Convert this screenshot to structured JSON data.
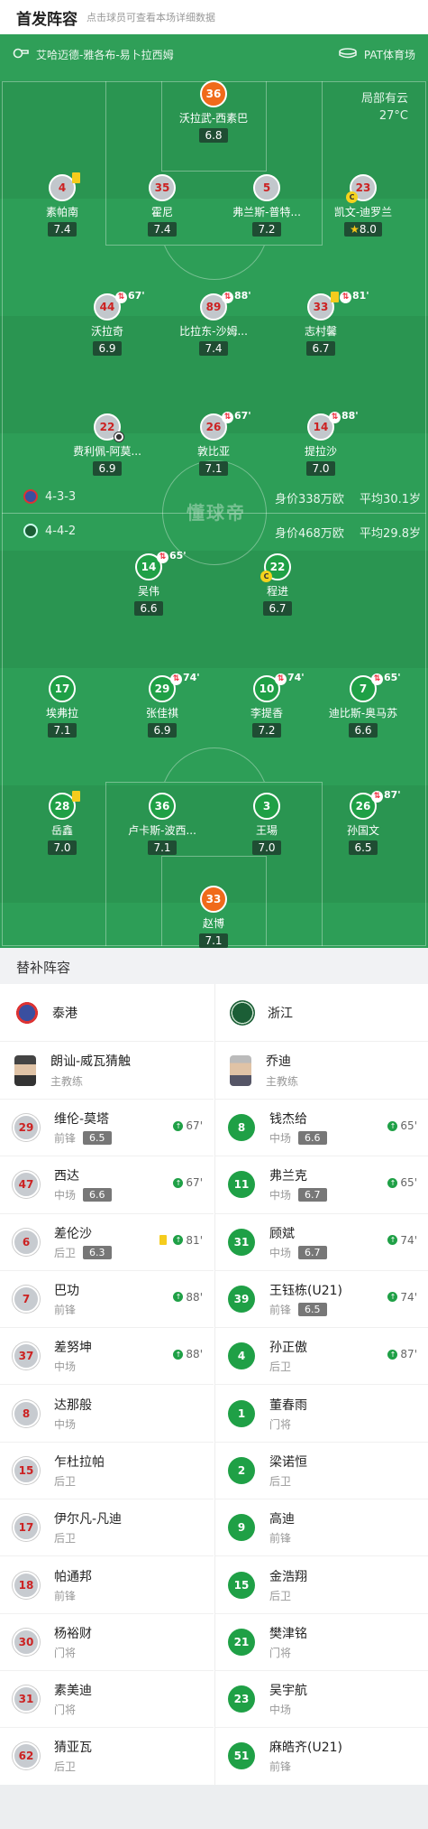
{
  "header": {
    "title": "首发阵容",
    "subtitle": "点击球员可查看本场详细数据"
  },
  "pitch": {
    "venue_left": "艾哈迈德-雅各布-易卜拉西姆",
    "venue_right": "PAT体育场",
    "weather": "局部有云",
    "temperature": "27°C",
    "watermark": "懂球帝",
    "home_form": {
      "formation": "4-3-3",
      "value": "身价338万欧",
      "age": "平均30.1岁"
    },
    "away_form": {
      "formation": "4-4-2",
      "value": "身价468万欧",
      "age": "平均29.8岁"
    }
  },
  "home_players": [
    {
      "num": "36",
      "name": "沃拉武-西素巴",
      "rating": "6.8",
      "gk": true
    },
    {
      "num": "4",
      "name": "素帕南",
      "rating": "7.4",
      "yellow": true
    },
    {
      "num": "35",
      "name": "霍尼",
      "rating": "7.4"
    },
    {
      "num": "5",
      "name": "弗兰斯-普特...",
      "rating": "7.2"
    },
    {
      "num": "23",
      "name": "凯文-迪罗兰",
      "rating": "8.0",
      "captain": "C",
      "best": true
    },
    {
      "num": "44",
      "name": "沃拉奇",
      "rating": "6.9",
      "sub": "67'"
    },
    {
      "num": "89",
      "name": "比拉东-沙姆...",
      "rating": "7.4",
      "sub": "88'"
    },
    {
      "num": "33",
      "name": "志村馨",
      "rating": "6.7",
      "sub": "81'",
      "yellow": true
    },
    {
      "num": "22",
      "name": "费利佩-阿莫...",
      "rating": "6.9",
      "goal": true
    },
    {
      "num": "26",
      "name": "敦比亚",
      "rating": "7.1",
      "sub": "67'"
    },
    {
      "num": "14",
      "name": "提拉沙",
      "rating": "7.0",
      "sub": "88'"
    }
  ],
  "away_players": [
    {
      "num": "14",
      "name": "吴伟",
      "rating": "6.6",
      "sub": "65'"
    },
    {
      "num": "22",
      "name": "程进",
      "rating": "6.7",
      "captain": "C"
    },
    {
      "num": "17",
      "name": "埃弗拉",
      "rating": "7.1"
    },
    {
      "num": "29",
      "name": "张佳祺",
      "rating": "6.9",
      "sub": "74'"
    },
    {
      "num": "10",
      "name": "李提香",
      "rating": "7.2",
      "sub": "74'"
    },
    {
      "num": "7",
      "name": "迪比斯-奥马苏",
      "rating": "6.6",
      "sub": "65'"
    },
    {
      "num": "28",
      "name": "岳鑫",
      "rating": "7.0",
      "yellow": true
    },
    {
      "num": "36",
      "name": "卢卡斯-波西...",
      "rating": "7.1"
    },
    {
      "num": "3",
      "name": "王瑒",
      "rating": "7.0"
    },
    {
      "num": "26",
      "name": "孙国文",
      "rating": "6.5",
      "sub": "87'"
    },
    {
      "num": "33",
      "name": "赵博",
      "rating": "7.1",
      "gk": true
    }
  ],
  "subs_title": "替补阵容",
  "home_team": {
    "name": "泰港",
    "coach": "朗讪-威瓦猜触",
    "coach_role": "主教练"
  },
  "away_team": {
    "name": "浙江",
    "coach": "乔迪",
    "coach_role": "主教练"
  },
  "home_subs": [
    {
      "num": "29",
      "name": "维伦-莫塔",
      "pos": "前锋",
      "rating": "6.5",
      "min": "67'"
    },
    {
      "num": "47",
      "name": "西达",
      "pos": "中场",
      "rating": "6.6",
      "min": "67'"
    },
    {
      "num": "6",
      "name": "差伦沙",
      "pos": "后卫",
      "rating": "6.3",
      "min": "81'",
      "yellow": true
    },
    {
      "num": "7",
      "name": "巴功",
      "pos": "前锋",
      "min": "88'"
    },
    {
      "num": "37",
      "name": "差努坤",
      "pos": "中场",
      "min": "88'"
    },
    {
      "num": "8",
      "name": "达那般",
      "pos": "中场"
    },
    {
      "num": "15",
      "name": "乍杜拉帕",
      "pos": "后卫"
    },
    {
      "num": "17",
      "name": "伊尔凡-凡迪",
      "pos": "后卫"
    },
    {
      "num": "18",
      "name": "帕通邦",
      "pos": "前锋"
    },
    {
      "num": "30",
      "name": "杨裕财",
      "pos": "门将"
    },
    {
      "num": "31",
      "name": "素美迪",
      "pos": "门将"
    },
    {
      "num": "62",
      "name": "猜亚瓦",
      "pos": "后卫"
    }
  ],
  "away_subs": [
    {
      "num": "8",
      "name": "钱杰给",
      "pos": "中场",
      "rating": "6.6",
      "min": "65'"
    },
    {
      "num": "11",
      "name": "弗兰克",
      "pos": "中场",
      "rating": "6.7",
      "min": "65'"
    },
    {
      "num": "31",
      "name": "顾斌",
      "pos": "中场",
      "rating": "6.7",
      "min": "74'"
    },
    {
      "num": "39",
      "name": "王钰栋(U21)",
      "pos": "前锋",
      "rating": "6.5",
      "min": "74'"
    },
    {
      "num": "4",
      "name": "孙正傲",
      "pos": "后卫",
      "min": "87'"
    },
    {
      "num": "1",
      "name": "董春雨",
      "pos": "门将"
    },
    {
      "num": "2",
      "name": "梁诺恒",
      "pos": "后卫"
    },
    {
      "num": "9",
      "name": "高迪",
      "pos": "前锋"
    },
    {
      "num": "15",
      "name": "金浩翔",
      "pos": "后卫"
    },
    {
      "num": "21",
      "name": "樊津铭",
      "pos": "门将"
    },
    {
      "num": "23",
      "name": "吴宇航",
      "pos": "中场"
    },
    {
      "num": "51",
      "name": "麻皓齐(U21)",
      "pos": "前锋"
    }
  ]
}
